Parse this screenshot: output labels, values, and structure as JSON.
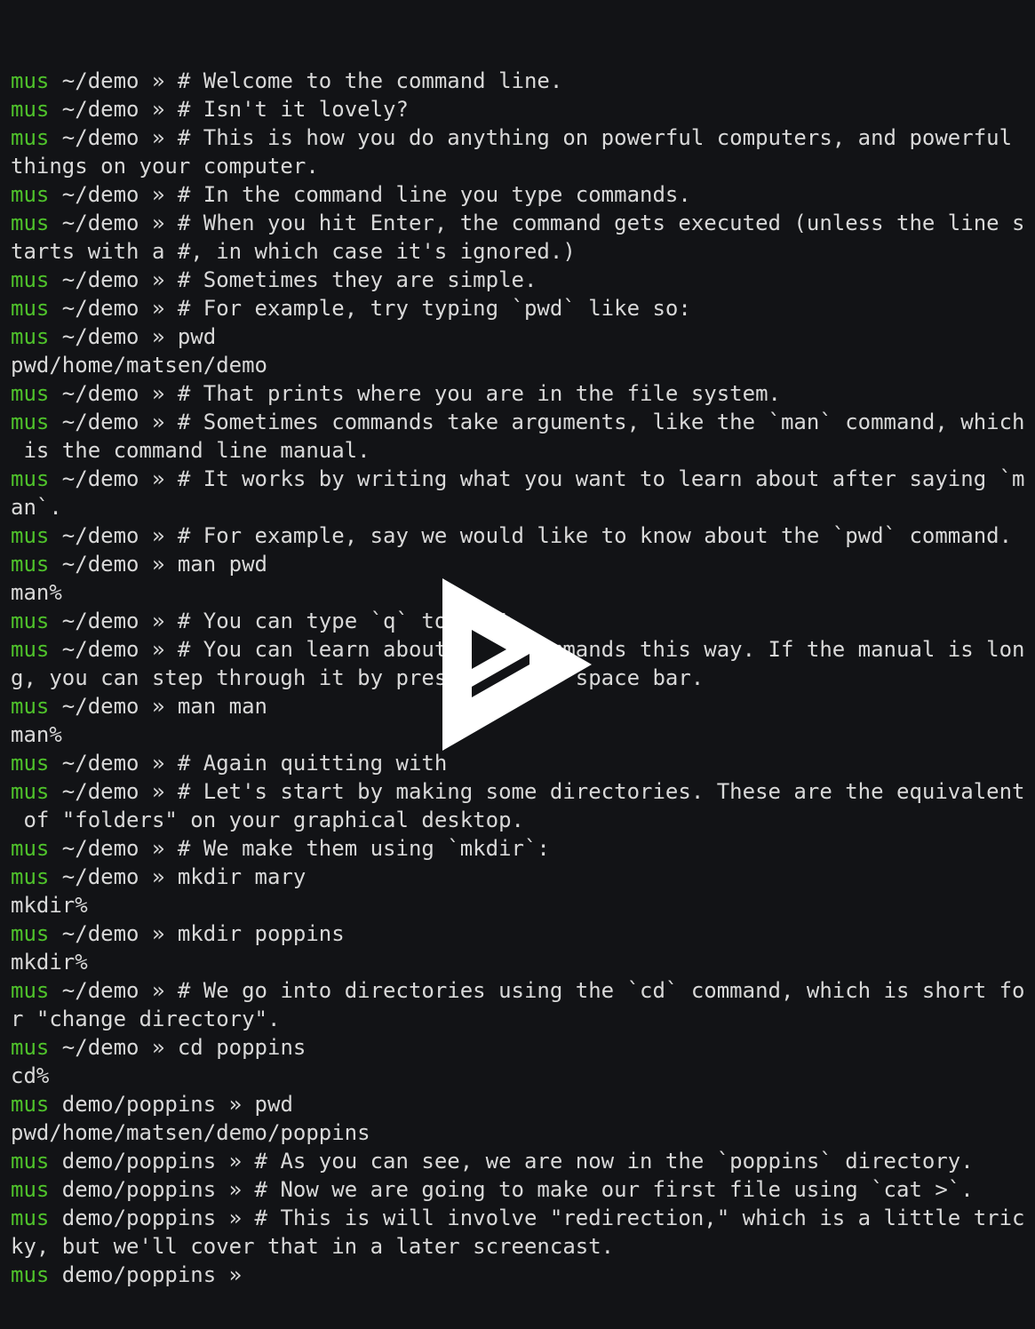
{
  "colors": {
    "background": "#121316",
    "text": "#d9d9d9",
    "prompt_user": "#4fc22b",
    "play_icon": "#ffffff"
  },
  "player": {
    "icon": "asciinema-play-icon"
  },
  "terminal": {
    "lines": [
      {
        "user": "mus",
        "rest": " ~/demo » # Welcome to the command line."
      },
      {
        "user": "mus",
        "rest": " ~/demo » # Isn't it lovely?"
      },
      {
        "user": "mus",
        "rest": " ~/demo » # This is how you do anything on powerful computers, and powerful"
      },
      {
        "user": "",
        "rest": "things on your computer."
      },
      {
        "user": "mus",
        "rest": " ~/demo » # In the command line you type commands."
      },
      {
        "user": "mus",
        "rest": " ~/demo » # When you hit Enter, the command gets executed (unless the line s"
      },
      {
        "user": "",
        "rest": "tarts with a #, in which case it's ignored.)"
      },
      {
        "user": "mus",
        "rest": " ~/demo » # Sometimes they are simple."
      },
      {
        "user": "mus",
        "rest": " ~/demo » # For example, try typing `pwd` like so:"
      },
      {
        "user": "mus",
        "rest": " ~/demo » pwd"
      },
      {
        "user": "",
        "rest": "pwd/home/matsen/demo"
      },
      {
        "user": "mus",
        "rest": " ~/demo » # That prints where you are in the file system."
      },
      {
        "user": "mus",
        "rest": " ~/demo » # Sometimes commands take arguments, like the `man` command, which"
      },
      {
        "user": "",
        "rest": " is the command line manual."
      },
      {
        "user": "mus",
        "rest": " ~/demo » # It works by writing what you want to learn about after saying `m"
      },
      {
        "user": "",
        "rest": "an`."
      },
      {
        "user": "mus",
        "rest": " ~/demo » # For example, say we would like to know about the `pwd` command."
      },
      {
        "user": "mus",
        "rest": " ~/demo » man pwd"
      },
      {
        "user": "",
        "rest": "man%"
      },
      {
        "user": "mus",
        "rest": " ~/demo » # You can type `q` to exit."
      },
      {
        "user": "mus",
        "rest": " ~/demo » # You can learn about many commands this way. If the manual is lon"
      },
      {
        "user": "",
        "rest": "g, you can step through it by pressing your space bar."
      },
      {
        "user": "mus",
        "rest": " ~/demo » man man"
      },
      {
        "user": "",
        "rest": "man%"
      },
      {
        "user": "mus",
        "rest": " ~/demo » # Again quitting with"
      },
      {
        "user": "mus",
        "rest": " ~/demo » # Let's start by making some directories. These are the equivalent"
      },
      {
        "user": "",
        "rest": " of \"folders\" on your graphical desktop."
      },
      {
        "user": "mus",
        "rest": " ~/demo » # We make them using `mkdir`:"
      },
      {
        "user": "mus",
        "rest": " ~/demo » mkdir mary"
      },
      {
        "user": "",
        "rest": "mkdir%"
      },
      {
        "user": "mus",
        "rest": " ~/demo » mkdir poppins"
      },
      {
        "user": "",
        "rest": "mkdir%"
      },
      {
        "user": "mus",
        "rest": " ~/demo » # We go into directories using the `cd` command, which is short fo"
      },
      {
        "user": "",
        "rest": "r \"change directory\"."
      },
      {
        "user": "mus",
        "rest": " ~/demo » cd poppins"
      },
      {
        "user": "",
        "rest": "cd%"
      },
      {
        "user": "mus",
        "rest": " demo/poppins » pwd"
      },
      {
        "user": "",
        "rest": "pwd/home/matsen/demo/poppins"
      },
      {
        "user": "mus",
        "rest": " demo/poppins » # As you can see, we are now in the `poppins` directory."
      },
      {
        "user": "mus",
        "rest": " demo/poppins » # Now we are going to make our first file using `cat >`."
      },
      {
        "user": "mus",
        "rest": " demo/poppins » # This is will involve \"redirection,\" which is a little tric"
      },
      {
        "user": "",
        "rest": "ky, but we'll cover that in a later screencast."
      },
      {
        "user": "mus",
        "rest": " demo/poppins » "
      }
    ]
  }
}
